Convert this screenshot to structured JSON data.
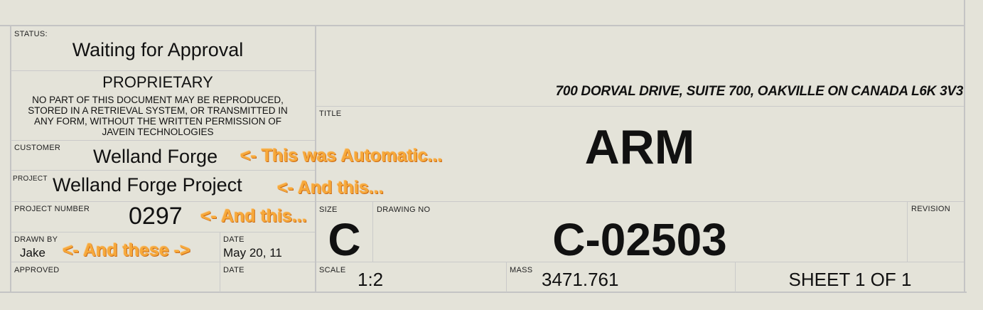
{
  "status": {
    "label": "STATUS:",
    "value": "Waiting for Approval"
  },
  "proprietary": {
    "heading": "PROPRIETARY",
    "lines": [
      "NO PART OF THIS DOCUMENT MAY BE REPRODUCED,",
      "STORED IN A RETRIEVAL SYSTEM, OR TRANSMITTED IN",
      "ANY FORM, WITHOUT THE WRITTEN PERMISSION OF",
      "JAVEIN TECHNOLOGIES"
    ]
  },
  "address": "700 DORVAL DRIVE, SUITE 700, OAKVILLE ON  CANADA L6K 3V3",
  "title": {
    "label": "TITLE",
    "value": "ARM"
  },
  "customer": {
    "label": "CUSTOMER",
    "value": "Welland Forge"
  },
  "project": {
    "label": "PROJECT",
    "value": "Welland Forge Project"
  },
  "project_number": {
    "label": "PROJECT NUMBER",
    "value": "0297"
  },
  "size": {
    "label": "SIZE",
    "value": "C"
  },
  "drawing_no": {
    "label": "DRAWING NO",
    "value": "C-02503"
  },
  "revision": {
    "label": "REVISION",
    "value": ""
  },
  "drawn_by": {
    "label": "DRAWN BY",
    "value": "Jake"
  },
  "drawn_date": {
    "label": "DATE",
    "value": "May 20, 11"
  },
  "approved": {
    "label": "APPROVED",
    "value": ""
  },
  "approved_date": {
    "label": "DATE",
    "value": ""
  },
  "scale": {
    "label": "SCALE",
    "value": "1:2"
  },
  "mass": {
    "label": "MASS",
    "value": "3471.761"
  },
  "sheet": "SHEET 1 OF 1",
  "annotations": {
    "customer": "<- This was Automatic...",
    "project": "<- And this...",
    "project_number": "<- And this...",
    "drawn_by": "<- And these ->"
  }
}
